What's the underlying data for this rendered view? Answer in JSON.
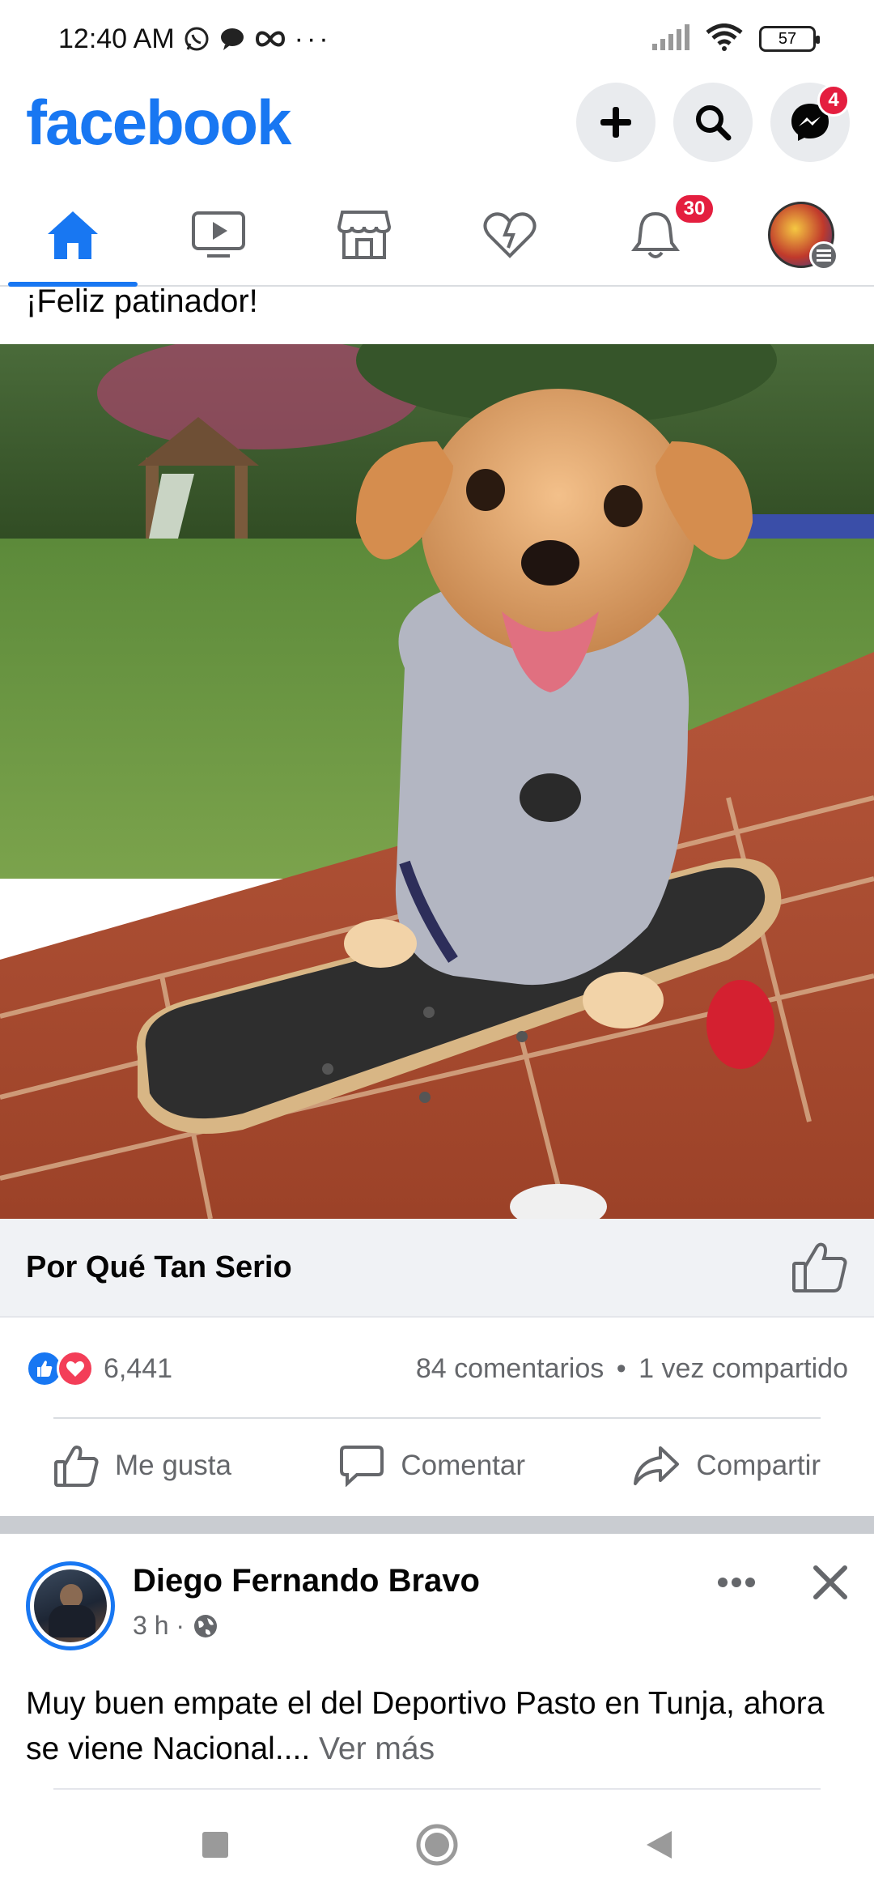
{
  "status_bar": {
    "time": "12:40 AM",
    "battery": "57"
  },
  "header": {
    "logo": "facebook",
    "messenger_badge": "4"
  },
  "nav": {
    "notifications_badge": "30"
  },
  "post1": {
    "caption": "¡Feliz patinador!",
    "image_icon": "puppy-on-skateboard-photo",
    "link_title": "Por Qué Tan Serio",
    "reaction_count": "6,441",
    "comments": "84 comentarios",
    "separator": "•",
    "shares": "1 vez compartido",
    "actions": {
      "like": "Me gusta",
      "comment": "Comentar",
      "share": "Compartir"
    }
  },
  "post2": {
    "author": "Diego Fernando Bravo",
    "time": "3 h ·",
    "text": "Muy buen empate el del Deportivo Pasto en Tunja, ahora se viene Nacional.... ",
    "more": "Ver más"
  },
  "colors": {
    "brand": "#1877f2",
    "badge": "#e41e3f",
    "love": "#f33e58"
  }
}
